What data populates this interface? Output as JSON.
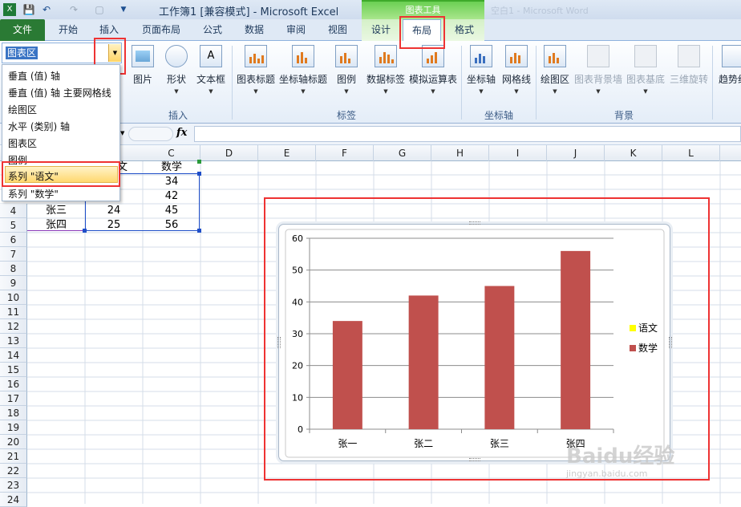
{
  "window": {
    "title": "工作簿1 [兼容模式] - Microsoft Excel",
    "context_header": "图表工具",
    "ghost_title": "空白1 - Microsoft Word"
  },
  "tabs": [
    {
      "label": "文件"
    },
    {
      "label": "开始"
    },
    {
      "label": "插入"
    },
    {
      "label": "页面布局"
    },
    {
      "label": "公式"
    },
    {
      "label": "数据"
    },
    {
      "label": "审阅"
    },
    {
      "label": "视图"
    },
    {
      "label": "设计"
    },
    {
      "label": "布局",
      "active": true
    },
    {
      "label": "格式"
    }
  ],
  "ribbon": {
    "selection_value": "图表区",
    "insert_group": {
      "label": "插入",
      "buttons": [
        "图片",
        "形状",
        "文本框"
      ]
    },
    "labels_group": {
      "label": "标签",
      "buttons": [
        "图表标题",
        "坐标轴标题",
        "图例",
        "数据标签",
        "模拟运算表"
      ]
    },
    "axes_group": {
      "label": "坐标轴",
      "buttons": [
        "坐标轴",
        "网格线"
      ]
    },
    "background_group": {
      "label": "背景",
      "buttons": [
        "绘图区",
        "图表背景墙",
        "图表基底",
        "三维旋转"
      ]
    },
    "analysis_partial": "趋势线"
  },
  "element_menu": {
    "items": [
      "垂直 (值) 轴",
      "垂直 (值) 轴 主要网格线",
      "绘图区",
      "水平 (类别) 轴",
      "图表区",
      "图例",
      "系列 \"语文\"",
      "系列 \"数学\""
    ],
    "highlighted": "系列 \"语文\""
  },
  "formula_bar": {
    "fx": "fx",
    "value": ""
  },
  "columns": [
    "C",
    "D",
    "E",
    "F",
    "G",
    "H",
    "I",
    "J",
    "K",
    "L"
  ],
  "rows": [
    "4",
    "5",
    "6",
    "7",
    "8",
    "9",
    "10",
    "11",
    "12",
    "13",
    "14",
    "15",
    "16",
    "17",
    "18",
    "19",
    "20",
    "21",
    "22",
    "23",
    "24"
  ],
  "cells": {
    "b1_fragment": "文",
    "c1": "数学",
    "c2": "34",
    "c3": "42",
    "a4": "张三",
    "b4": "24",
    "c4": "45",
    "a5": "张四",
    "b5": "25",
    "c5": "56"
  },
  "chart_data": {
    "type": "bar",
    "categories": [
      "张一",
      "张二",
      "张三",
      "张四"
    ],
    "series": [
      {
        "name": "语文",
        "values": [
          null,
          null,
          null,
          null
        ],
        "color": "#ffff00"
      },
      {
        "name": "数学",
        "values": [
          34,
          42,
          45,
          56
        ],
        "color": "#c0504d"
      }
    ],
    "ylim": [
      0,
      60
    ],
    "yticks": [
      0,
      10,
      20,
      30,
      40,
      50,
      60
    ],
    "grid": true,
    "legend": "right"
  },
  "colors": {
    "accent_red": "#e33333",
    "file_tab": "#2a7a34",
    "context_tab": "#6bcf53"
  },
  "watermark": {
    "text": "Baidu经验",
    "url": "jingyan.baidu.com"
  }
}
